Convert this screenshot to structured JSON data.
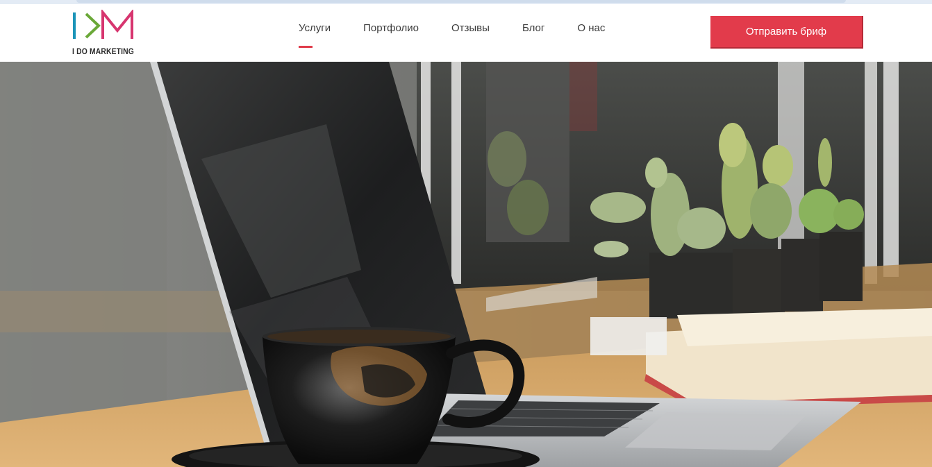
{
  "brand": {
    "name": "I DO MARKETING",
    "colors": {
      "teal": "#1b94b8",
      "green": "#6aa838",
      "pink": "#d7356f",
      "accent": "#e23b4b"
    }
  },
  "nav": {
    "items": [
      {
        "label": "Услуги",
        "active": true
      },
      {
        "label": "Портфолио",
        "active": false
      },
      {
        "label": "Отзывы",
        "active": false
      },
      {
        "label": "Блог",
        "active": false
      },
      {
        "label": "О нас",
        "active": false
      }
    ]
  },
  "cta": {
    "label": "Отправить бриф"
  },
  "hero": {
    "image": "laptop-coffee-cactus-photo"
  }
}
